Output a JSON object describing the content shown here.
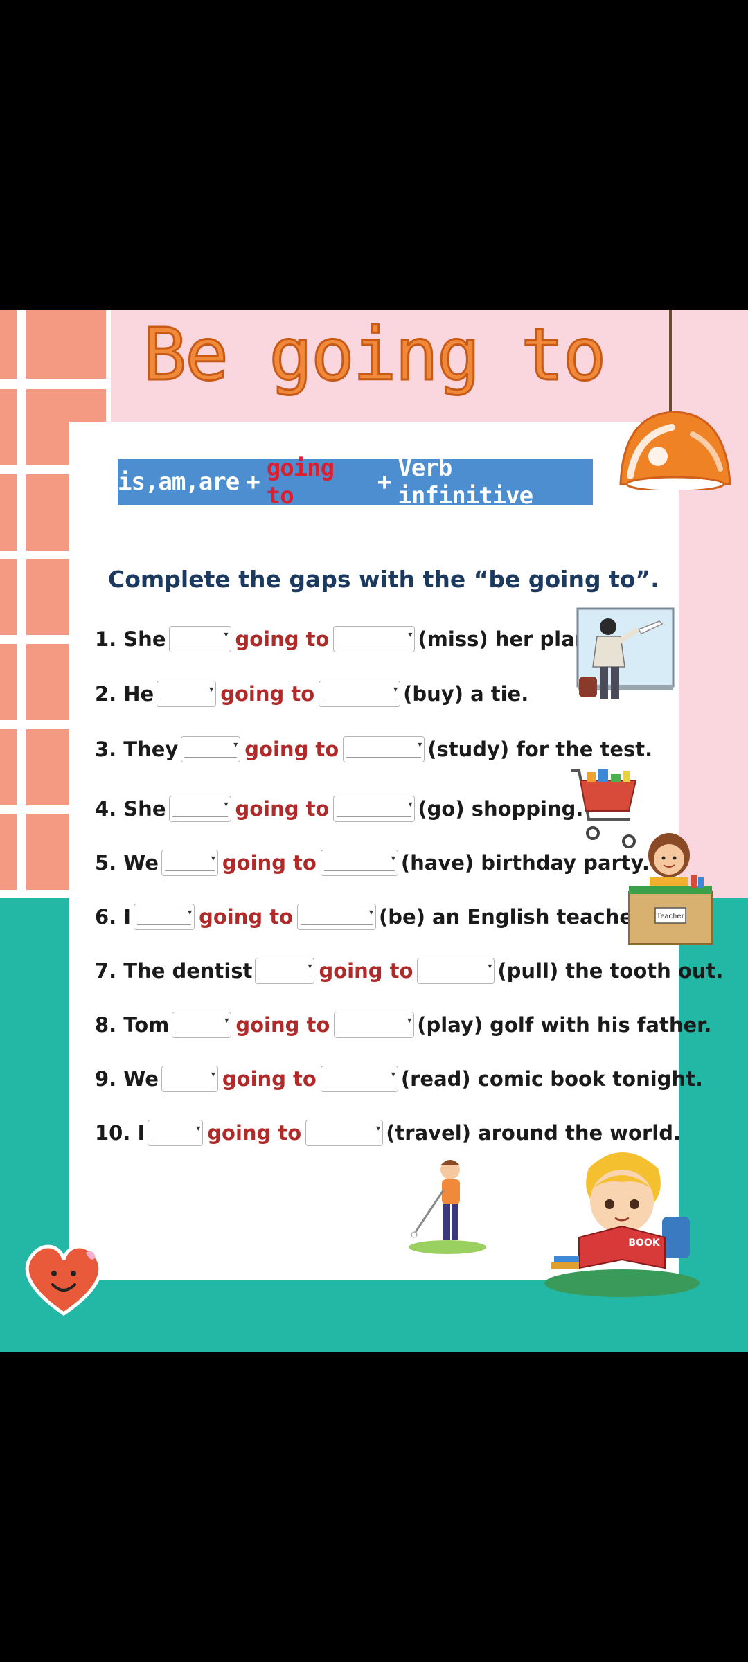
{
  "worksheet": {
    "title": "Be going to",
    "formula": {
      "part1": "is,am,are",
      "plus": "+",
      "part2": "going to",
      "part3": "Verb infinitive"
    },
    "instruction": "Complete the gaps with the “be going to”.",
    "going_to": "going to",
    "items": [
      {
        "label": "1. She",
        "rest": "(miss) her plane."
      },
      {
        "label": "2. He",
        "rest": "(buy) a tie."
      },
      {
        "label": "3. They",
        "rest": "(study) for the test."
      },
      {
        "label": "4. She",
        "rest": "(go) shopping."
      },
      {
        "label": "5. We",
        "rest": "(have) birthday party."
      },
      {
        "label": "6. I",
        "rest": "(be) an English teacher."
      },
      {
        "label": "7. The dentist",
        "rest": "(pull) the tooth out."
      },
      {
        "label": "8. Tom",
        "rest": "(play) golf with his father."
      },
      {
        "label": "9. We",
        "rest": "(read) comic book tonight."
      },
      {
        "label": "10. I",
        "rest": "(travel) around the world."
      }
    ],
    "desk_sign": "Teacher",
    "book_text": "BOOK"
  },
  "colors": {
    "pink": "#fad6df",
    "teal": "#22b8a5",
    "tile": "#f59a82",
    "title": "#f08a3a",
    "formula_bg": "#4d8ed0",
    "going_to": "#b02a2a"
  }
}
